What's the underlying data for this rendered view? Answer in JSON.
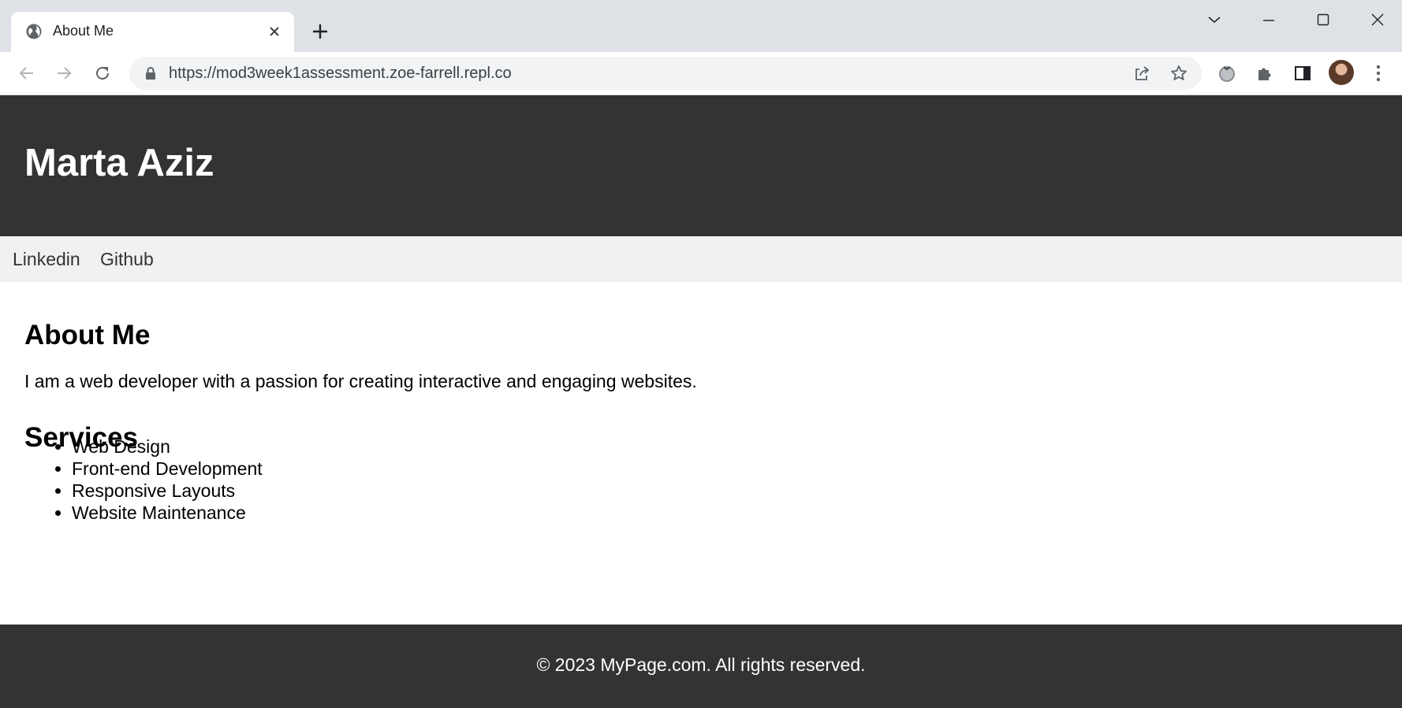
{
  "browser": {
    "tab": {
      "title": "About Me",
      "favicon": "globe-icon"
    },
    "new_tab_icon": "plus-icon",
    "window_controls": [
      "chevron-down-icon",
      "minimize-icon",
      "maximize-icon",
      "close-icon"
    ],
    "url": "https://mod3week1assessment.zoe-farrell.repl.co",
    "toolbar_icons": [
      "share-icon",
      "star-icon",
      "extension-tomato-icon",
      "puzzle-icon",
      "side-panel-icon",
      "avatar",
      "more-icon"
    ]
  },
  "site": {
    "header": {
      "title": "Marta Aziz",
      "background": "#333333"
    },
    "nav": {
      "items": [
        "Linkedin",
        "Github"
      ],
      "background": "#f1f1f1"
    },
    "about": {
      "heading": "About Me",
      "text": "I am a web developer with a passion for creating interactive and engaging websites."
    },
    "services": {
      "heading": "Services",
      "items": [
        "Web Design",
        "Front-end Development",
        "Responsive Layouts",
        "Website Maintenance"
      ]
    },
    "footer": {
      "text": "© 2023 MyPage.com. All rights reserved."
    }
  }
}
